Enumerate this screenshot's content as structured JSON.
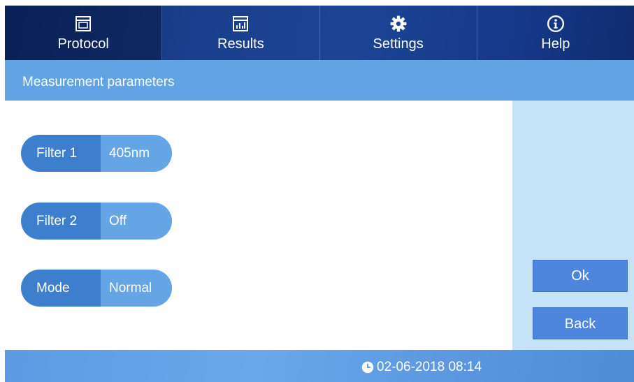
{
  "nav": {
    "items": [
      {
        "label": "Protocol",
        "icon": "window-icon",
        "active": true
      },
      {
        "label": "Results",
        "icon": "bar-chart-icon",
        "active": false
      },
      {
        "label": "Settings",
        "icon": "gear-icon",
        "active": false
      },
      {
        "label": "Help",
        "icon": "info-icon",
        "active": false
      }
    ]
  },
  "subheader": {
    "title": "Measurement parameters"
  },
  "params": [
    {
      "label": "Filter 1",
      "value": "405nm"
    },
    {
      "label": "Filter 2",
      "value": "Off"
    },
    {
      "label": "Mode",
      "value": "Normal"
    }
  ],
  "buttons": {
    "ok": "Ok",
    "back": "Back"
  },
  "status": {
    "datetime": "02-06-2018 08:14"
  },
  "colors": {
    "nav_bg": "#1a3f8c",
    "subheader_bg": "#62a3e4",
    "param_label_bg": "#3d7fcc",
    "param_value_bg": "#65a5e6",
    "side_panel_bg": "#c5e3f6",
    "button_bg": "#4d86dc"
  }
}
